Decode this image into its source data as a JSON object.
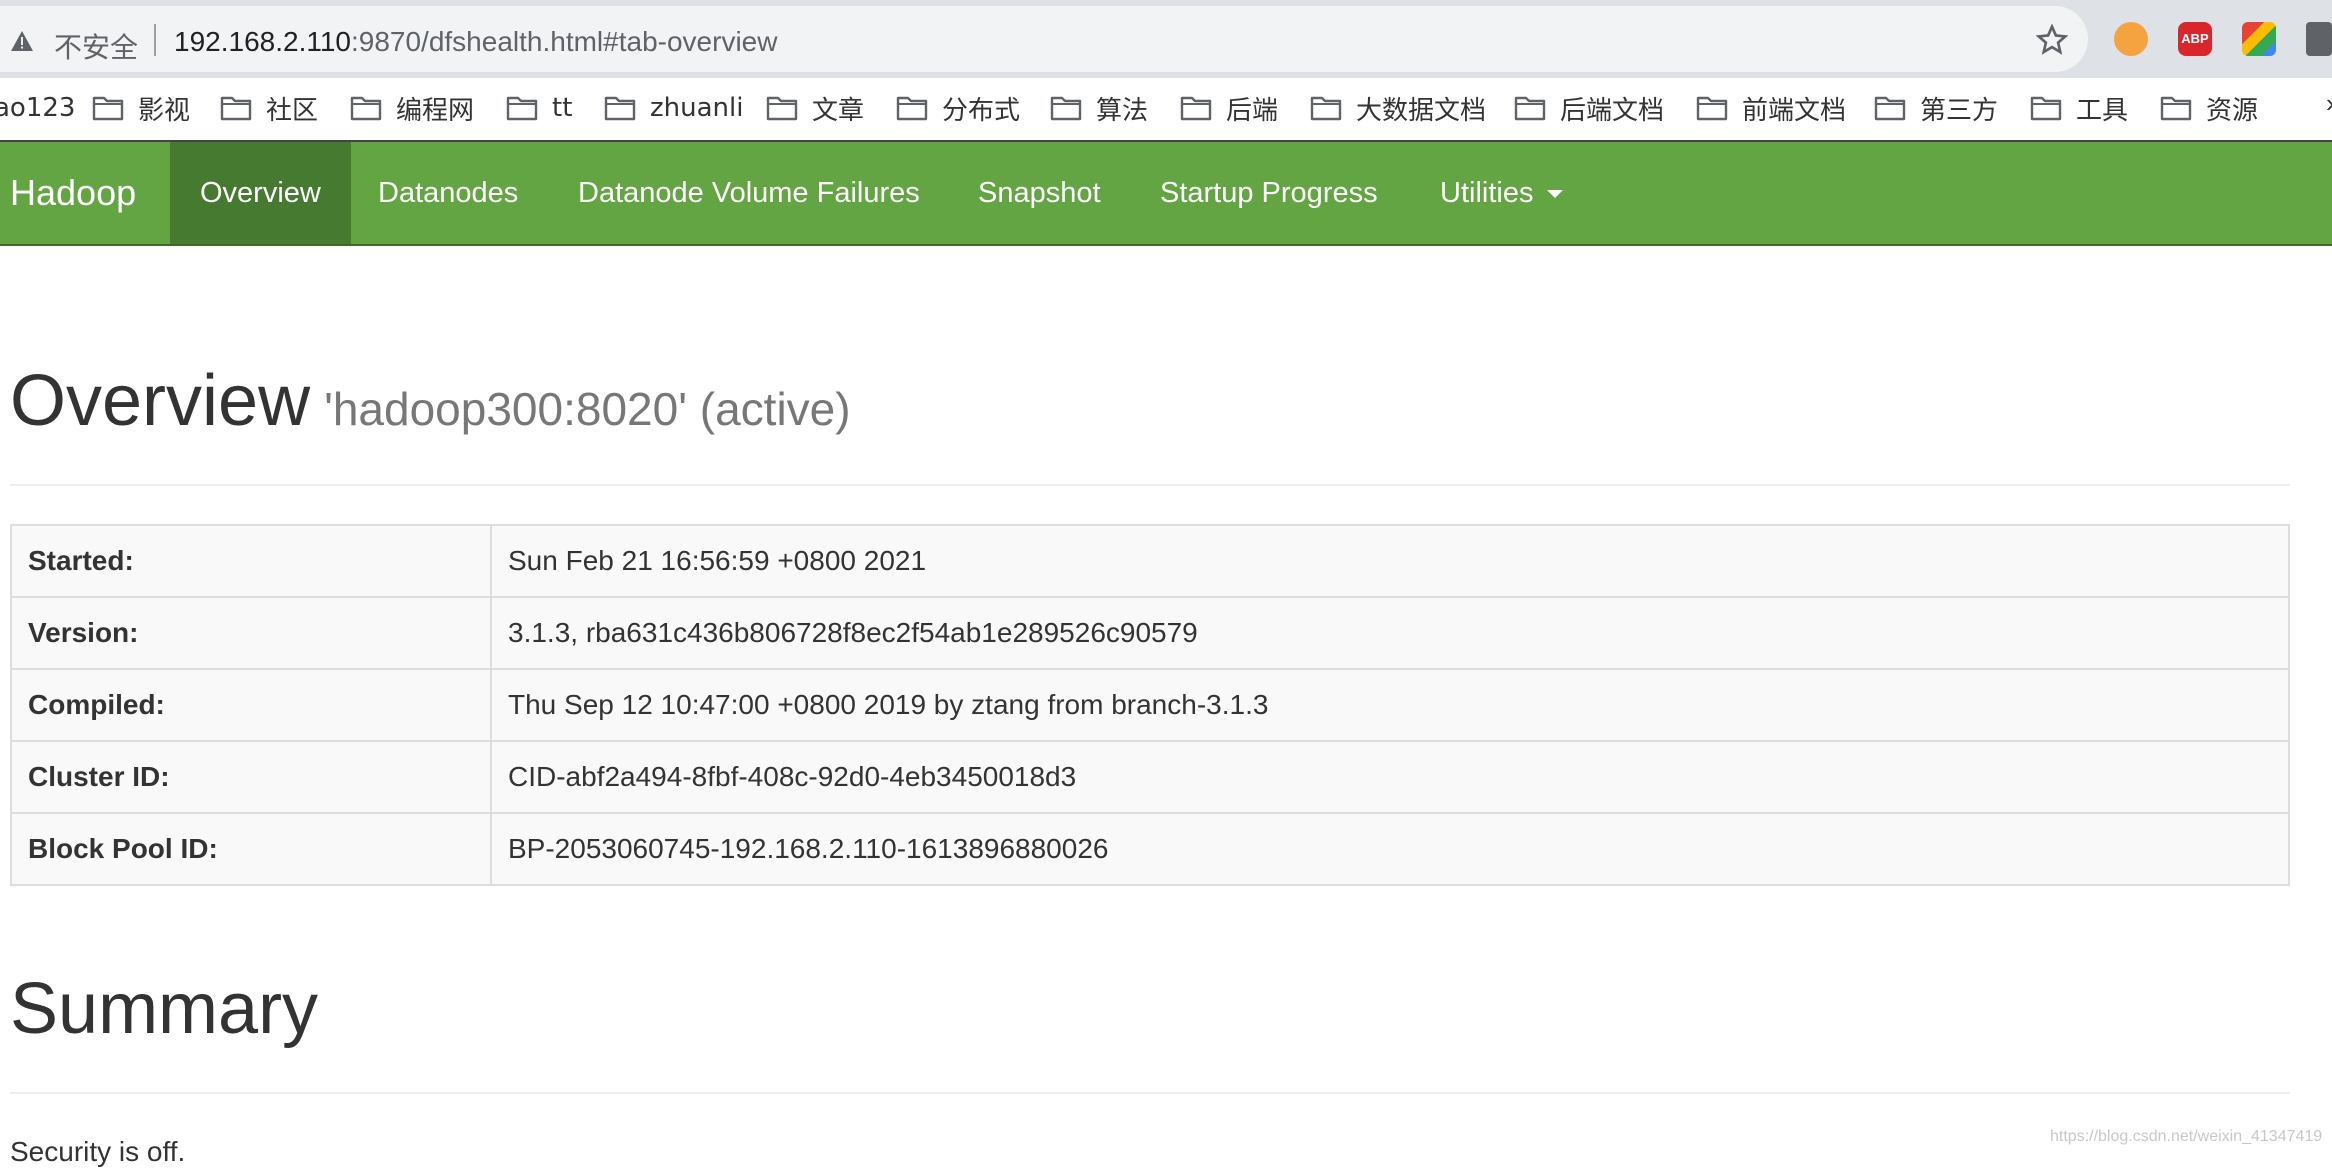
{
  "browser": {
    "insecure_label": "不安全",
    "url_host": "192.168.2.110",
    "url_rest": ":9870/dfshealth.html#tab-overview",
    "extensions": [
      "infinity-extension",
      "adblock-plus",
      "multicolor-extension",
      "extensions-puzzle"
    ],
    "abp_text": "ABP"
  },
  "bookmarks": {
    "first": "ao123",
    "folders": [
      "影视",
      "社区",
      "编程网",
      "tt",
      "zhuanli",
      "文章",
      "分布式",
      "算法",
      "后端",
      "大数据文档",
      "后端文档",
      "前端文档",
      "第三方",
      "工具",
      "资源"
    ],
    "more": "»"
  },
  "navbar": {
    "brand": "Hadoop",
    "items": [
      "Overview",
      "Datanodes",
      "Datanode Volume Failures",
      "Snapshot",
      "Startup Progress",
      "Utilities"
    ],
    "active_index": 0
  },
  "overview": {
    "title": "Overview",
    "subtitle": "'hadoop300:8020' (active)",
    "rows": [
      {
        "label": "Started:",
        "value": "Sun Feb 21 16:56:59 +0800 2021"
      },
      {
        "label": "Version:",
        "value": "3.1.3, rba631c436b806728f8ec2f54ab1e289526c90579"
      },
      {
        "label": "Compiled:",
        "value": "Thu Sep 12 10:47:00 +0800 2019 by ztang from branch-3.1.3"
      },
      {
        "label": "Cluster ID:",
        "value": "CID-abf2a494-8fbf-408c-92d0-4eb3450018d3"
      },
      {
        "label": "Block Pool ID:",
        "value": "BP-2053060745-192.168.2.110-1613896880026"
      }
    ]
  },
  "summary": {
    "title": "Summary",
    "security": "Security is off."
  },
  "watermark": "https://blog.csdn.net/weixin_41347419",
  "colors": {
    "navbar": "#62a542",
    "navbar_active": "#457a30"
  }
}
